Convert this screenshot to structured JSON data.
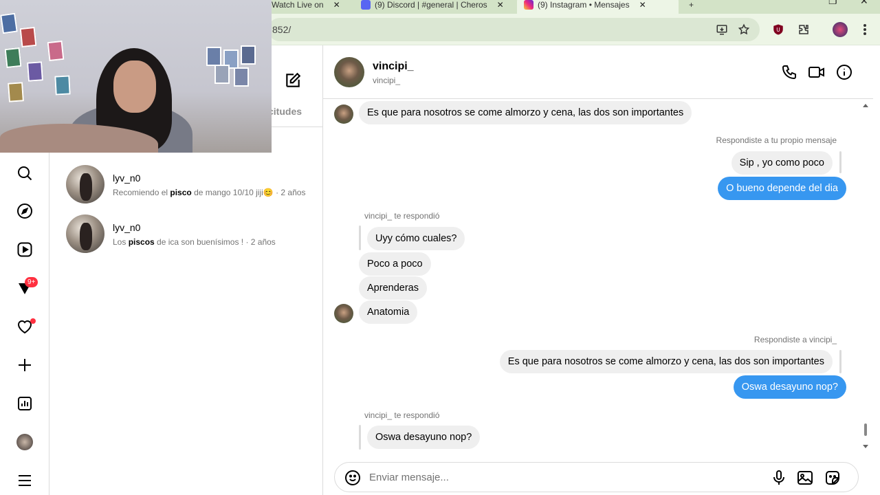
{
  "browser": {
    "tabs": [
      {
        "title": "Watch Live on",
        "icon": "generic-tab-icon"
      },
      {
        "title": "(9) Discord | #general | Cheros",
        "icon": "discord-icon"
      },
      {
        "title": "(9) Instagram • Mensajes",
        "icon": "instagram-icon"
      }
    ],
    "new_tab": "+",
    "url": "852/"
  },
  "list": {
    "requests_tab": "citudes",
    "conversations": [
      {
        "name": "lyv_n0",
        "prefix": "Recomiendo el ",
        "bold": "pisco",
        "suffix": " de mango 10/10 jiji😊",
        "time": " · 2 años"
      },
      {
        "name": "lyv_n0",
        "prefix": "Los ",
        "bold": "piscos",
        "suffix": " de ica son buenísimos !",
        "time": " · 2 años"
      }
    ]
  },
  "nav": {
    "notifications_badge": "9+"
  },
  "chat": {
    "name": "vincipi_",
    "username": "vincipi_",
    "messages": {
      "m1": "Es que para nosotros se come almorzo y cena, las dos son importantes",
      "meta1": "Respondiste a tu propio mensaje",
      "m2": "Sip , yo como poco",
      "m3": "O bueno depende del dia",
      "meta2": "vincipi_ te respondió",
      "m4": "Uyy cómo cuales?",
      "m5": "Poco a poco",
      "m6": "Aprenderas",
      "m7": "Anatomia",
      "meta3": "Respondiste a vincipi_",
      "m8": "Es que para nosotros se come almorzo y cena, las dos son importantes",
      "m9": "Oswa desayuno nop?",
      "meta4": "vincipi_ te respondió",
      "m10": "Oswa desayuno nop?"
    },
    "composer_placeholder": "Enviar mensaje..."
  }
}
